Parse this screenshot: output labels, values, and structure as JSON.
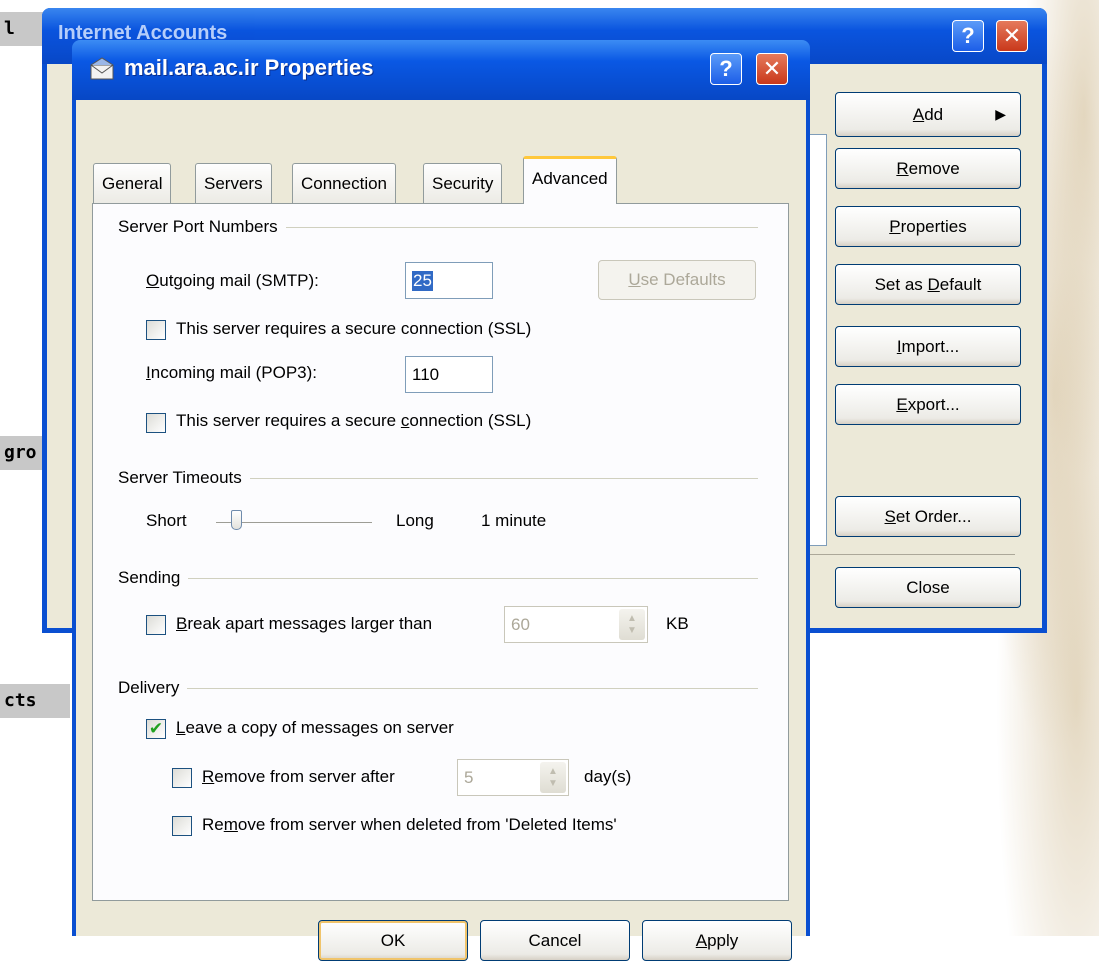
{
  "background": {
    "label_1": "l",
    "label_2": "gro",
    "label_3": "cts"
  },
  "internet_accounts": {
    "title": "Internet Accounts",
    "help_icon": "question-icon",
    "close_icon": "close-icon",
    "buttons": {
      "add": {
        "pre": "",
        "key": "A",
        "post": "dd"
      },
      "remove": {
        "pre": "",
        "key": "R",
        "post": "emove"
      },
      "properties": {
        "pre": "",
        "key": "P",
        "post": "roperties"
      },
      "set_default": {
        "pre": "Set as ",
        "key": "D",
        "post": "efault"
      },
      "import": {
        "pre": "",
        "key": "I",
        "post": "mport..."
      },
      "export": {
        "pre": "",
        "key": "E",
        "post": "xport..."
      },
      "set_order": {
        "pre": "",
        "key": "S",
        "post": "et Order..."
      },
      "close": "Close"
    }
  },
  "dialog": {
    "title": "mail.ara.ac.ir Properties",
    "tabs": [
      "General",
      "Servers",
      "Connection",
      "Security",
      "Advanced"
    ],
    "active_tab": "Advanced",
    "server_ports": {
      "group_title": "Server Port Numbers",
      "outgoing": {
        "pre": "",
        "key": "O",
        "post": "utgoing mail (SMTP):"
      },
      "outgoing_value": "25",
      "use_defaults": {
        "pre": "",
        "key": "U",
        "post": "se Defaults"
      },
      "ssl_outgoing": {
        "pre": "This server requires a secure connection (SSL)",
        "key": "",
        "post": ""
      },
      "incoming": {
        "pre": "",
        "key": "I",
        "post": "ncoming mail (POP3):"
      },
      "incoming_value": "110",
      "ssl_incoming": {
        "pre": "This server requires a secure ",
        "key": "c",
        "post": "onnection (SSL)"
      }
    },
    "timeouts": {
      "group_title": "Server Timeouts",
      "short": "Short",
      "long": "Long",
      "value_text": "1 minute",
      "slider_level": 0.1
    },
    "sending": {
      "group_title": "Sending",
      "break_apart": {
        "pre": "",
        "key": "B",
        "post": "reak apart messages larger than"
      },
      "break_value": "60",
      "unit": "KB"
    },
    "delivery": {
      "group_title": "Delivery",
      "leave_copy": {
        "pre": "",
        "key": "L",
        "post": "eave a copy of messages on server"
      },
      "leave_copy_checked": true,
      "remove_after": {
        "pre": "",
        "key": "R",
        "post": "emove from server after"
      },
      "remove_after_value": "5",
      "days": "day(s)",
      "remove_deleted": {
        "pre": "Re",
        "key": "m",
        "post": "ove from server when deleted from 'Deleted Items'"
      }
    },
    "footer": {
      "ok": "OK",
      "cancel": "Cancel",
      "apply": {
        "pre": "",
        "key": "A",
        "post": "pply"
      }
    }
  }
}
